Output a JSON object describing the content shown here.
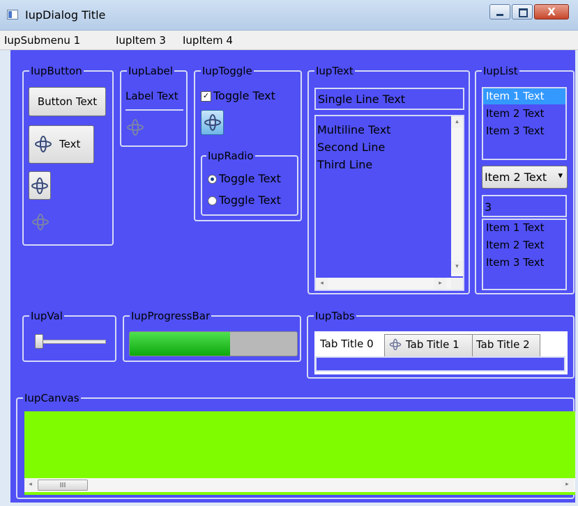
{
  "window": {
    "title": "IupDialog Title",
    "close_glyph": "X"
  },
  "menubar": {
    "items": [
      "IupSubmenu 1",
      "IupItem 3",
      "IupItem 4"
    ]
  },
  "frames": {
    "button": "IupButton",
    "label": "IupLabel",
    "toggle": "IupToggle",
    "radio": "IupRadio",
    "text": "IupText",
    "list": "IupList",
    "val": "IupVal",
    "progress": "IupProgressBar",
    "tabs": "IupTabs",
    "canvas": "IupCanvas"
  },
  "buttons": {
    "text_button": "Button Text",
    "image_text_button": "Text"
  },
  "label": {
    "text": "Label Text"
  },
  "toggle": {
    "text": "Toggle Text",
    "checked": true
  },
  "radio": {
    "options": [
      "Toggle Text",
      "Toggle Text"
    ],
    "selected_index": 0
  },
  "text": {
    "single_line": "Single Line Text",
    "multiline": [
      "Multiline Text",
      "Second Line",
      "Third Line"
    ]
  },
  "list": {
    "items": [
      "Item 1 Text",
      "Item 2 Text",
      "Item 3 Text"
    ],
    "selected_index": 0,
    "dropdown_value": "Item 2 Text",
    "edit_value": "3",
    "edit_list_items": [
      "Item 1 Text",
      "Item 2 Text",
      "Item 3 Text"
    ]
  },
  "val": {
    "value": 0.05
  },
  "progress": {
    "value": 0.6
  },
  "tabs": {
    "titles": [
      "Tab Title 0",
      "Tab Title 1",
      "Tab Title 2"
    ],
    "active_index": 0
  },
  "scroll": {
    "canvas_thumb_glyph": "III"
  },
  "colors": {
    "client_bg": "#5050f5",
    "canvas_bg": "#80fc00",
    "progress_fill": "#17c017",
    "selection": "#3399ff"
  },
  "icons": {
    "rotor": "rotor-icon",
    "scroll_left": "◂",
    "scroll_right": "▸",
    "scroll_up": "▴",
    "scroll_down": "▾",
    "dropdown": "▾"
  }
}
